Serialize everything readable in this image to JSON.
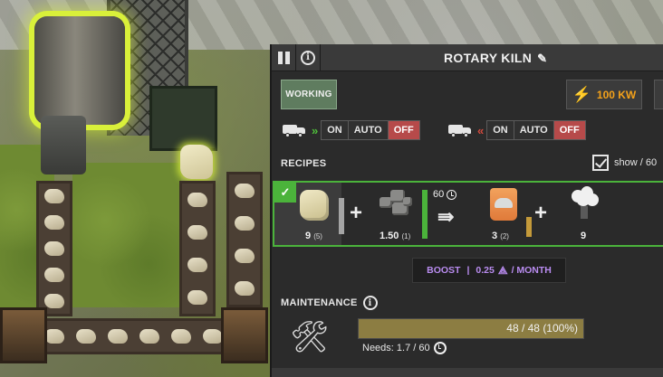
{
  "window": {
    "title": "ROTARY KILN"
  },
  "status": {
    "state_label": "WORKING",
    "power_label": "100 KW"
  },
  "logistics": {
    "input": {
      "on_label": "ON",
      "auto_label": "AUTO",
      "off_label": "OFF",
      "selected": "OFF"
    },
    "output": {
      "on_label": "ON",
      "auto_label": "AUTO",
      "off_label": "OFF",
      "selected": "OFF"
    }
  },
  "recipes": {
    "heading": "RECIPES",
    "show_label": "show / 60",
    "show_checked": true,
    "active_recipe": {
      "selected": true,
      "inputs": [
        {
          "icon": "limestone-icon",
          "amount": "9",
          "buffer": "(5)"
        },
        {
          "icon": "rubble-icon",
          "amount": "1.50",
          "buffer": "(1)"
        }
      ],
      "duration": "60",
      "outputs": [
        {
          "icon": "cement-bag-icon",
          "amount": "3",
          "buffer": "(2)"
        },
        {
          "icon": "exhaust-icon",
          "amount": "9"
        }
      ]
    }
  },
  "boost": {
    "label": "BOOST",
    "separator": "|",
    "cost": "0.25",
    "period": "/ MONTH"
  },
  "maintenance": {
    "heading": "MAINTENANCE",
    "value_text": "48 / 48 (100%)",
    "fill_fraction": 1.0,
    "needs_text": "Needs: 1.7 / 60"
  },
  "colors": {
    "working": "#5f7c5f",
    "power": "#f3a11a",
    "off_active": "#b64a4a",
    "selection": "#4bb33b",
    "boost": "#b98cf0",
    "maintenance_fill": "#8c7d42",
    "highlight": "#d9f03a"
  }
}
